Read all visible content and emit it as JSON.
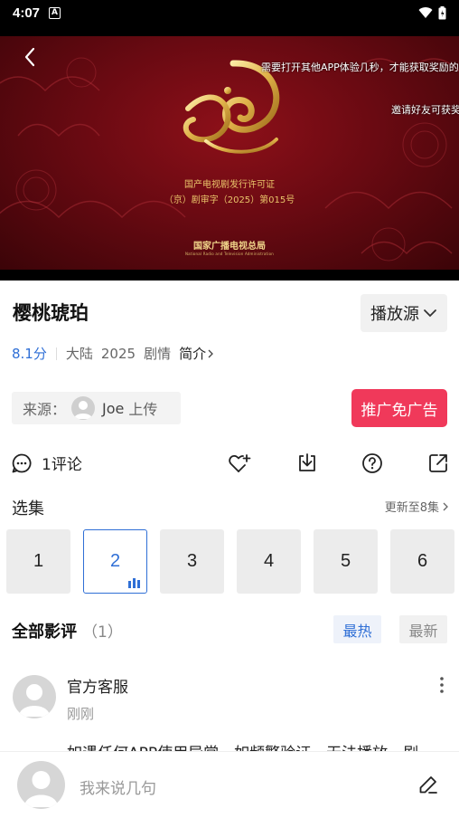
{
  "status_bar": {
    "time": "4:07",
    "app_indicator": "A"
  },
  "video": {
    "danmu": [
      "需要打开其他APP体验几秒，才能获取奖励的",
      "邀请好友可获奖"
    ],
    "license_line1": "国产电视剧发行许可证",
    "license_line2": "（京）剧审字（2025）第015号",
    "authority": "国家广播电视总局",
    "authority_en": "National Radio and Television Administration"
  },
  "show": {
    "title": "樱桃琥珀",
    "source_button": "播放源",
    "score": "8.1分",
    "region": "大陆",
    "year": "2025",
    "genre": "剧情",
    "intro_link": "简介"
  },
  "uploader": {
    "label": "来源：",
    "name": "Joe",
    "suffix": "上传"
  },
  "promo_button": "推广免广告",
  "actions": {
    "comment_count": "1评论"
  },
  "episodes": {
    "title": "选集",
    "update_text": "更新至8集",
    "items": [
      "1",
      "2",
      "3",
      "4",
      "5",
      "6"
    ],
    "active_index": 1
  },
  "reviews": {
    "title": "全部影评",
    "count": "（1）",
    "sort_hot": "最热",
    "sort_new": "最新",
    "items": [
      {
        "author": "官方客服",
        "time": "刚刚",
        "text": "如遇任何APP使用异常，如频繁验证、无法播放、剧"
      }
    ]
  },
  "comment_input": {
    "placeholder": "我来说几句"
  },
  "colors": {
    "accent_blue": "#2f6fd6",
    "promo_red": "#f0395a",
    "poster_red": "#8d1019"
  }
}
